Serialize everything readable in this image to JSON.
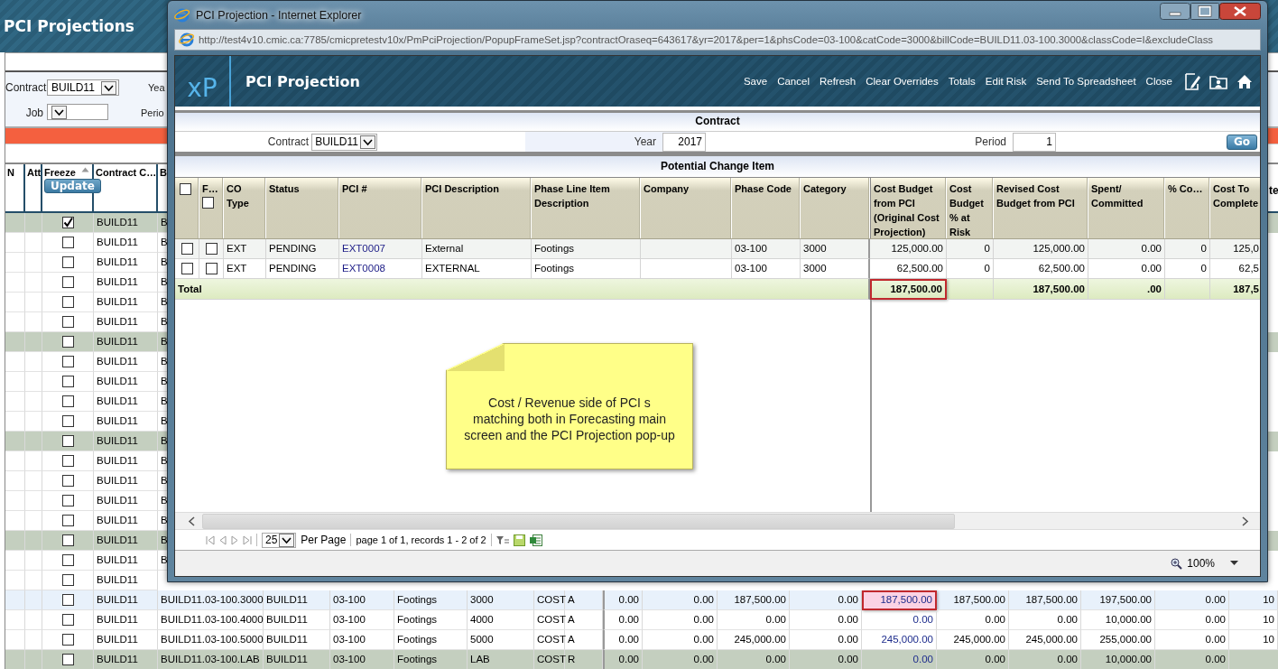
{
  "app": {
    "title": "PCI Projections",
    "filters": [
      {
        "label": "Contract",
        "value": "BUILD11"
      },
      {
        "label": "Job"
      }
    ],
    "side_labels": [
      "Yea",
      "Perio"
    ],
    "grid": {
      "columns": [
        "N",
        "Att",
        "Freeze",
        "Contract C…",
        "B"
      ],
      "update_button": "Update",
      "edge_heading": "te",
      "rows": [
        {
          "shaded": true,
          "selected": false,
          "frozen": true,
          "cells": [
            "",
            "",
            "",
            "BUILD11",
            "B"
          ]
        },
        {
          "shaded": false,
          "selected": false,
          "frozen": false,
          "cells": [
            "",
            "",
            "",
            "BUILD11",
            "B"
          ]
        },
        {
          "shaded": false,
          "selected": false,
          "frozen": false,
          "cells": [
            "",
            "",
            "",
            "BUILD11",
            "B"
          ]
        },
        {
          "shaded": false,
          "selected": false,
          "frozen": false,
          "cells": [
            "",
            "",
            "",
            "BUILD11",
            "B"
          ]
        },
        {
          "shaded": false,
          "selected": false,
          "frozen": false,
          "cells": [
            "",
            "",
            "",
            "BUILD11",
            "B"
          ]
        },
        {
          "shaded": false,
          "selected": false,
          "frozen": false,
          "cells": [
            "",
            "",
            "",
            "BUILD11",
            "B"
          ]
        },
        {
          "shaded": true,
          "selected": false,
          "frozen": false,
          "cells": [
            "",
            "",
            "",
            "BUILD11",
            "B"
          ]
        },
        {
          "shaded": false,
          "selected": false,
          "frozen": false,
          "cells": [
            "",
            "",
            "",
            "BUILD11",
            "B"
          ]
        },
        {
          "shaded": false,
          "selected": false,
          "frozen": false,
          "cells": [
            "",
            "",
            "",
            "BUILD11",
            "B"
          ]
        },
        {
          "shaded": false,
          "selected": false,
          "frozen": false,
          "cells": [
            "",
            "",
            "",
            "BUILD11",
            "B"
          ]
        },
        {
          "shaded": false,
          "selected": false,
          "frozen": false,
          "cells": [
            "",
            "",
            "",
            "BUILD11",
            "B"
          ]
        },
        {
          "shaded": true,
          "selected": false,
          "frozen": false,
          "cells": [
            "",
            "",
            "",
            "BUILD11",
            "B"
          ]
        },
        {
          "shaded": false,
          "selected": false,
          "frozen": false,
          "cells": [
            "",
            "",
            "",
            "BUILD11",
            "B"
          ]
        },
        {
          "shaded": false,
          "selected": false,
          "frozen": false,
          "cells": [
            "",
            "",
            "",
            "BUILD11",
            "B"
          ]
        },
        {
          "shaded": false,
          "selected": false,
          "frozen": false,
          "cells": [
            "",
            "",
            "",
            "BUILD11",
            "B"
          ]
        },
        {
          "shaded": false,
          "selected": false,
          "frozen": false,
          "cells": [
            "",
            "",
            "",
            "BUILD11",
            "B"
          ]
        },
        {
          "shaded": true,
          "selected": false,
          "frozen": false,
          "cells": [
            "",
            "",
            "",
            "BUILD11",
            "B"
          ]
        },
        {
          "shaded": false,
          "selected": false,
          "frozen": false,
          "cells": [
            "",
            "",
            "",
            "BUILD11",
            "B"
          ]
        },
        {
          "shaded": false,
          "selected": false,
          "frozen": false,
          "cells": [
            "",
            "",
            "",
            "BUILD11"
          ]
        },
        {
          "shaded": false,
          "selected": true,
          "frozen": false,
          "cells": [
            "",
            "",
            "",
            "BUILD11",
            "BUILD11.03-100.3000",
            "BUILD11",
            "03-100",
            "Footings",
            "3000",
            "COST",
            "A",
            "0.00",
            "0.00",
            "187,500.00",
            "0.00",
            {
              "text": "187,500.00",
              "marked": true
            },
            "187,500.00",
            "187,500.00",
            "197,500.00",
            "0.00",
            "10"
          ]
        },
        {
          "shaded": false,
          "selected": false,
          "frozen": false,
          "cells": [
            "",
            "",
            "",
            "BUILD11",
            "BUILD11.03-100.4000",
            "BUILD11",
            "03-100",
            "Footings",
            "4000",
            "COST",
            "A",
            "0.00",
            "0.00",
            "0.00",
            "0.00",
            "0.00",
            "0.00",
            "0.00",
            "10,000.00",
            "0.00",
            "10"
          ]
        },
        {
          "shaded": false,
          "selected": false,
          "frozen": false,
          "cells": [
            "",
            "",
            "",
            "BUILD11",
            "BUILD11.03-100.5000",
            "BUILD11",
            "03-100",
            "Footings",
            "5000",
            "COST",
            "A",
            "0.00",
            "0.00",
            "245,000.00",
            "0.00",
            "245,000.00",
            "245,000.00",
            "245,000.00",
            "255,000.00",
            "0.00",
            "10"
          ]
        },
        {
          "shaded": true,
          "selected": false,
          "frozen": false,
          "cells": [
            "",
            "",
            "",
            "BUILD11",
            "BUILD11.03-100.LAB",
            "BUILD11",
            "03-100",
            "Footings",
            "LAB",
            "COST",
            "R",
            "0.00",
            "0.00",
            "0.00",
            "0.00",
            "0.00",
            "0.00",
            "0.00",
            "10,000.00",
            "0.00"
          ]
        }
      ]
    }
  },
  "popup": {
    "window_title": "PCI Projection - Internet Explorer",
    "url": "http://test4v10.cmic.ca:7785/cmicpretestv10x/PmPciProjection/PopupFrameSet.jsp?contractOraseq=643617&yr=2017&per=1&phsCode=03-100&catCode=3000&billCode=BUILD11.03-100.3000&classCode=I&excludeClass",
    "logo": "xP",
    "app_title": "PCI Projection",
    "actions": [
      "Save",
      "Cancel",
      "Refresh",
      "Clear Overrides",
      "Totals",
      "Edit Risk",
      "Send To Spreadsheet",
      "Close"
    ],
    "contract_section": "Contract",
    "filters": {
      "contract_label": "Contract",
      "contract": "BUILD11",
      "year_label": "Year",
      "year": "2017",
      "period_label": "Period",
      "period": "1",
      "go": "Go"
    },
    "grid_title": "Potential Change Item",
    "header_checked": false,
    "freeze_header_checked": false,
    "columns": [
      "",
      "F…",
      "CO Type",
      "Status",
      "PCI #",
      "PCI Description",
      "Phase Line Item Description",
      "Company",
      "Phase Code",
      "Category",
      "Cost Budget from PCI (Original Cost Projection)",
      "Cost Budget % at Risk",
      "Revised Cost Budget from PCI",
      "Spent/ Committed",
      "% Co…",
      "Cost To Complete"
    ],
    "rows": [
      {
        "checked": false,
        "frozen": false,
        "cells": [
          "",
          "",
          "EXT",
          "PENDING",
          "EXT0007",
          "External",
          "Footings",
          "",
          "03-100",
          "3000",
          "125,000.00",
          "0",
          "125,000.00",
          "0.00",
          "0",
          "125,0"
        ]
      },
      {
        "checked": false,
        "frozen": false,
        "cells": [
          "",
          "",
          "EXT",
          "PENDING",
          "EXT0008",
          "EXTERNAL",
          "Footings",
          "",
          "03-100",
          "3000",
          "62,500.00",
          "0",
          "62,500.00",
          "0.00",
          "0",
          "62,5"
        ]
      }
    ],
    "total": {
      "label": "Total",
      "cells": [
        {
          "text": "187,500.00",
          "marked": true
        },
        "",
        "187,500.00",
        ".00",
        "",
        "187,5"
      ]
    },
    "pager": {
      "page_size": "25",
      "per_page": "Per Page",
      "info": "page 1 of 1, records 1 - 2 of 2"
    },
    "zoom": "100%"
  },
  "note": "Cost / Revenue side of PCI s matching both in Forecasting main screen and the PCI Projection pop-up"
}
